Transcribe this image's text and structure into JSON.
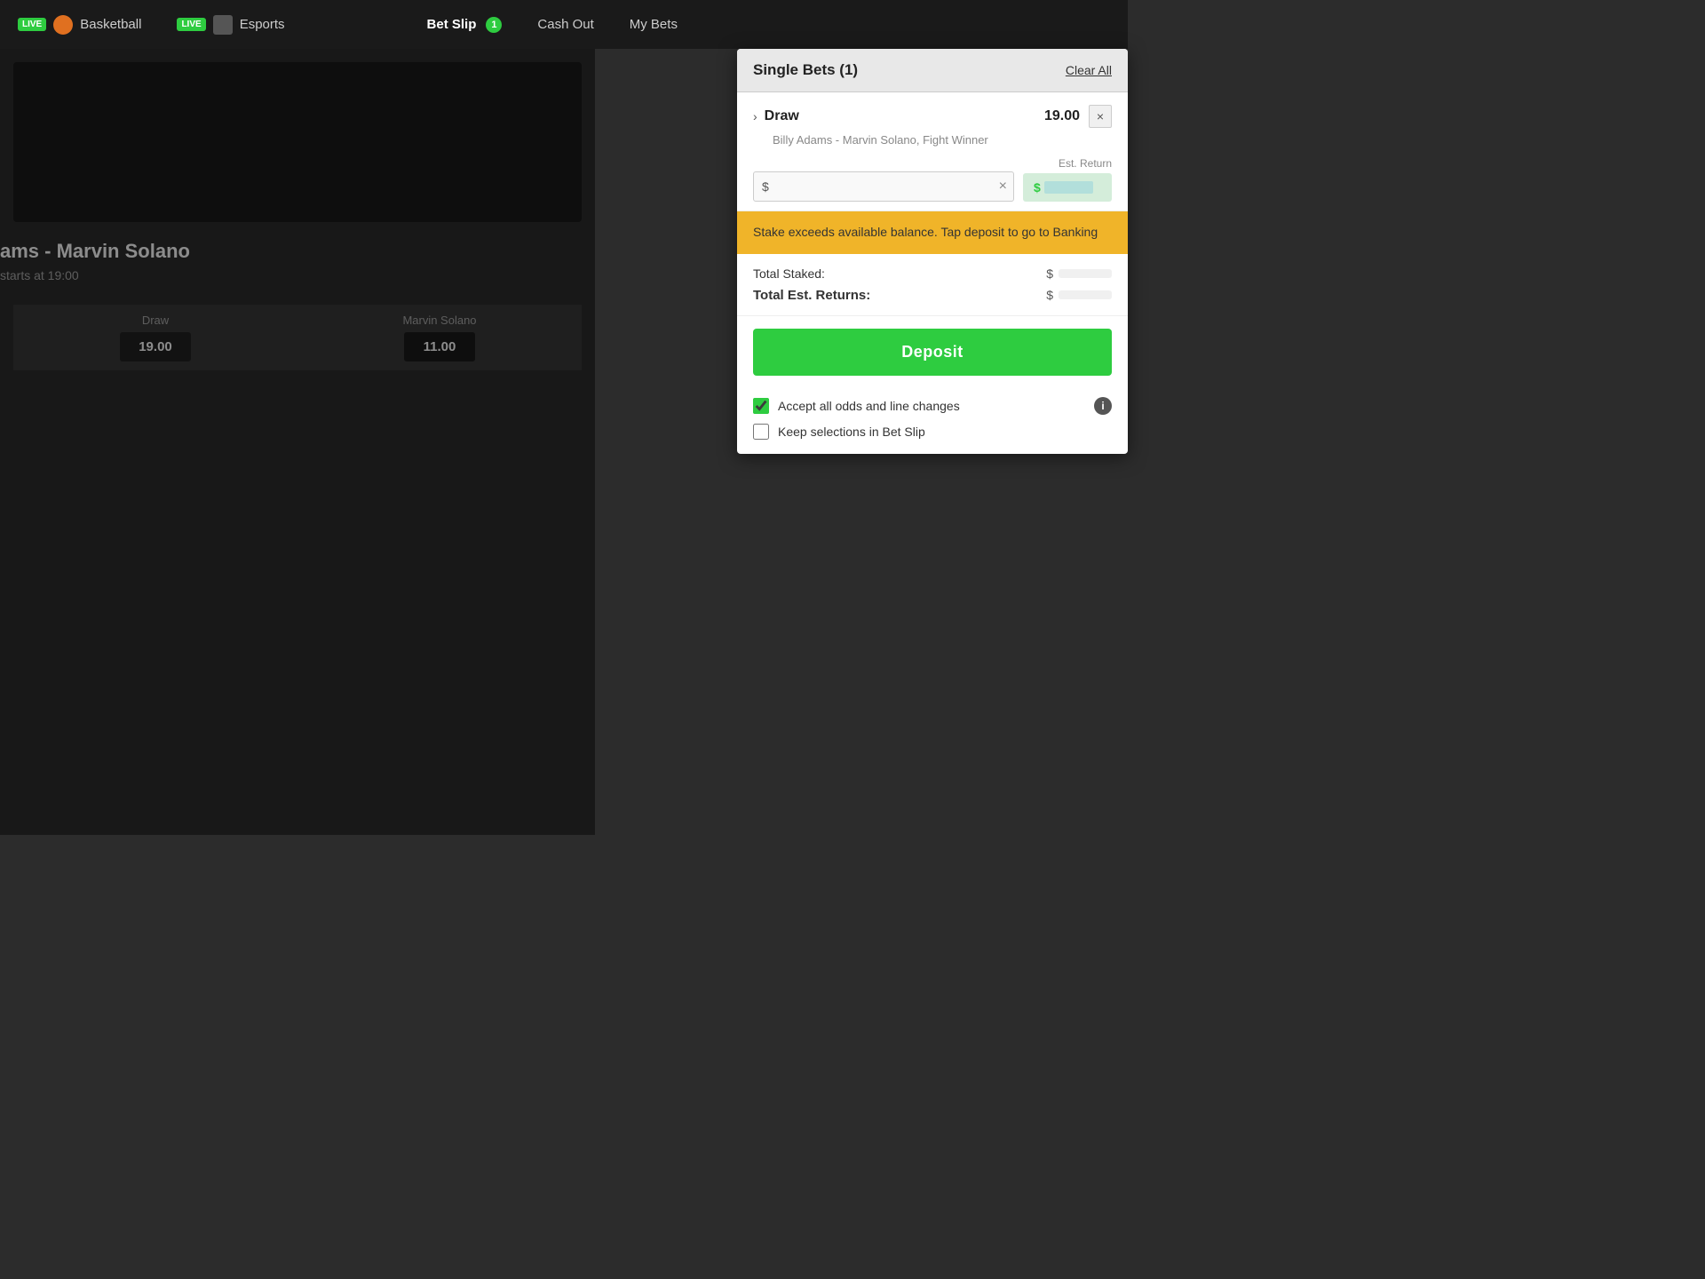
{
  "nav": {
    "basketball_live": "LIVE",
    "basketball_label": "Basketball",
    "esports_live": "LIVE",
    "esports_label": "Esports",
    "bet_slip_label": "Bet Slip",
    "bet_slip_count": "1",
    "cash_out_label": "Cash Out",
    "my_bets_label": "My Bets"
  },
  "game": {
    "title": "ams - Marvin Solano",
    "time": "starts at 19:00",
    "options": [
      {
        "label": "Draw",
        "odds": "19.00",
        "selected": true
      },
      {
        "label": "Marvin Solano",
        "odds": "11.00",
        "selected": false
      }
    ]
  },
  "bet_slip": {
    "title": "Single Bets (1)",
    "clear_all": "Clear All",
    "bet": {
      "chevron": "›",
      "selection": "Draw",
      "odds": "19.00",
      "subtitle": "Billy Adams - Marvin Solano, Fight Winner",
      "stake_prefix": "$",
      "stake_placeholder": "",
      "clear_btn": "×",
      "est_return_label": "Est. Return",
      "est_return_prefix": "$"
    },
    "warning": "Stake exceeds available balance. Tap deposit to go to Banking",
    "totals": {
      "staked_label": "Total Staked:",
      "staked_prefix": "$",
      "returns_label": "Total Est. Returns:",
      "returns_prefix": "$"
    },
    "deposit_button": "Deposit",
    "checkboxes": [
      {
        "id": "accept-odds",
        "label": "Accept all odds and line changes",
        "checked": true,
        "show_info": true
      },
      {
        "id": "keep-selections",
        "label": "Keep selections in Bet Slip",
        "checked": false,
        "show_info": false
      }
    ]
  }
}
